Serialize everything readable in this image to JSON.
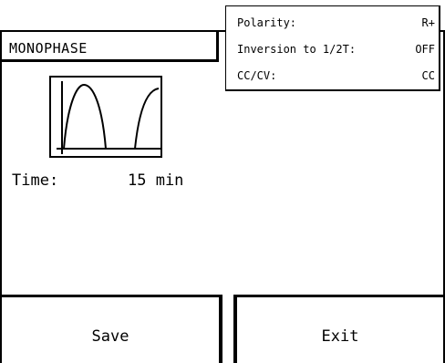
{
  "mode": {
    "title": "MONOPHASE",
    "waveform_icon": "monophase-waveform-icon"
  },
  "settings": {
    "polarity": {
      "label": "Polarity:",
      "value": "R+"
    },
    "inversion": {
      "label": "Inversion to 1/2T:",
      "value": "OFF"
    },
    "ccv": {
      "label": "CC/CV:",
      "value": "CC"
    }
  },
  "time": {
    "label": "Time:",
    "value": "15 min"
  },
  "buttons": {
    "save_label": "Save",
    "exit_label": "Exit"
  }
}
